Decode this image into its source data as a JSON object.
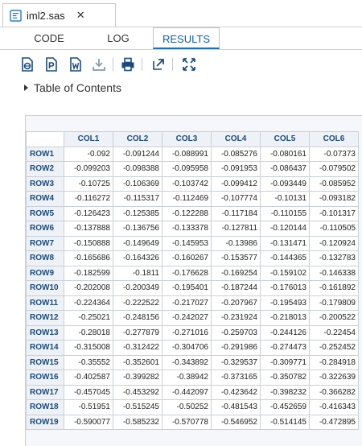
{
  "window": {
    "file_tab": "iml2.sas",
    "close_glyph": "✕"
  },
  "subtabs": [
    {
      "label": "CODE"
    },
    {
      "label": "LOG"
    },
    {
      "label": "RESULTS"
    }
  ],
  "toolbar": {
    "icons": [
      "html-download-icon",
      "pdf-download-icon",
      "rtf-download-icon",
      "download-icon",
      "print-icon",
      "new-window-icon",
      "maximize-icon"
    ]
  },
  "toc": {
    "label": "Table of Contents"
  },
  "table": {
    "columns": [
      "COL1",
      "COL2",
      "COL3",
      "COL4",
      "COL5",
      "COL6"
    ],
    "rows": [
      {
        "label": "ROW1",
        "values": [
          "-0.092",
          "-0.091244",
          "-0.088991",
          "-0.085276",
          "-0.080161",
          "-0.07373"
        ]
      },
      {
        "label": "ROW2",
        "values": [
          "-0.099203",
          "-0.098388",
          "-0.095958",
          "-0.091953",
          "-0.086437",
          "-0.079502"
        ]
      },
      {
        "label": "ROW3",
        "values": [
          "-0.10725",
          "-0.106369",
          "-0.103742",
          "-0.099412",
          "-0.093449",
          "-0.085952"
        ]
      },
      {
        "label": "ROW4",
        "values": [
          "-0.116272",
          "-0.115317",
          "-0.112469",
          "-0.107774",
          "-0.10131",
          "-0.093182"
        ]
      },
      {
        "label": "ROW5",
        "values": [
          "-0.126423",
          "-0.125385",
          "-0.122288",
          "-0.117184",
          "-0.110155",
          "-0.101317"
        ]
      },
      {
        "label": "ROW6",
        "values": [
          "-0.137888",
          "-0.136756",
          "-0.133378",
          "-0.127811",
          "-0.120144",
          "-0.110505"
        ]
      },
      {
        "label": "ROW7",
        "values": [
          "-0.150888",
          "-0.149649",
          "-0.145953",
          "-0.13986",
          "-0.131471",
          "-0.120924"
        ]
      },
      {
        "label": "ROW8",
        "values": [
          "-0.165686",
          "-0.164326",
          "-0.160267",
          "-0.153577",
          "-0.144365",
          "-0.132783"
        ]
      },
      {
        "label": "ROW9",
        "values": [
          "-0.182599",
          "-0.1811",
          "-0.176628",
          "-0.169254",
          "-0.159102",
          "-0.146338"
        ]
      },
      {
        "label": "ROW10",
        "values": [
          "-0.202008",
          "-0.200349",
          "-0.195401",
          "-0.187244",
          "-0.176013",
          "-0.161892"
        ]
      },
      {
        "label": "ROW11",
        "values": [
          "-0.224364",
          "-0.222522",
          "-0.217027",
          "-0.207967",
          "-0.195493",
          "-0.179809"
        ]
      },
      {
        "label": "ROW12",
        "values": [
          "-0.25021",
          "-0.248156",
          "-0.242027",
          "-0.231924",
          "-0.218013",
          "-0.200522"
        ]
      },
      {
        "label": "ROW13",
        "values": [
          "-0.28018",
          "-0.277879",
          "-0.271016",
          "-0.259703",
          "-0.244126",
          "-0.22454"
        ]
      },
      {
        "label": "ROW14",
        "values": [
          "-0.315008",
          "-0.312422",
          "-0.304706",
          "-0.291986",
          "-0.274473",
          "-0.252452"
        ]
      },
      {
        "label": "ROW15",
        "values": [
          "-0.35552",
          "-0.352601",
          "-0.343892",
          "-0.329537",
          "-0.309771",
          "-0.284918"
        ]
      },
      {
        "label": "ROW16",
        "values": [
          "-0.402587",
          "-0.399282",
          "-0.38942",
          "-0.373165",
          "-0.350782",
          "-0.322639"
        ]
      },
      {
        "label": "ROW17",
        "values": [
          "-0.457045",
          "-0.453292",
          "-0.442097",
          "-0.423642",
          "-0.398232",
          "-0.366282"
        ]
      },
      {
        "label": "ROW18",
        "values": [
          "-0.51951",
          "-0.515245",
          "-0.50252",
          "-0.481543",
          "-0.452659",
          "-0.416343"
        ]
      },
      {
        "label": "ROW19",
        "values": [
          "-0.590077",
          "-0.585232",
          "-0.570778",
          "-0.546952",
          "-0.514145",
          "-0.472895"
        ]
      }
    ]
  }
}
